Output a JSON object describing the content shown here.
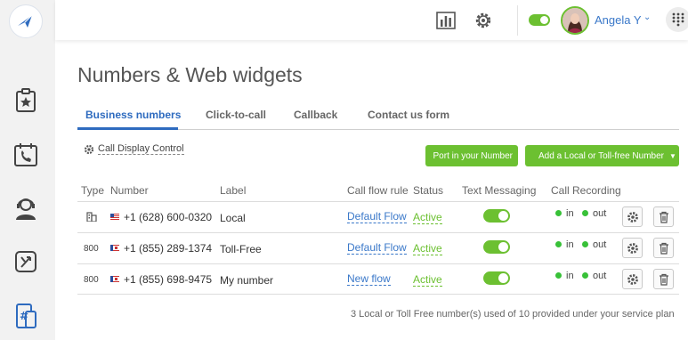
{
  "page": {
    "title": "Numbers & Web widgets"
  },
  "topbar": {
    "user_name": "Angela Y",
    "toggle_on": true
  },
  "sidebar": {
    "items": [
      {
        "icon": "clipboard-star-icon"
      },
      {
        "icon": "calendar-phone-icon"
      },
      {
        "icon": "agent-headset-icon"
      },
      {
        "icon": "call-flow-icon"
      },
      {
        "icon": "numbers-hash-icon"
      }
    ]
  },
  "tabs": [
    {
      "label": "Business numbers",
      "active": true
    },
    {
      "label": "Click-to-call",
      "active": false
    },
    {
      "label": "Callback",
      "active": false
    },
    {
      "label": "Contact us form",
      "active": false
    }
  ],
  "actions": {
    "call_display_control": "Call Display Control",
    "port_number": "Port in your Number",
    "add_number": "Add a Local or Toll-free Number"
  },
  "table": {
    "headers": [
      "Type",
      "Number",
      "Label",
      "Call flow rule",
      "Status",
      "Text Messaging",
      "Call Recording"
    ],
    "rows": [
      {
        "type": "",
        "type_icon": "building-icon",
        "number": "+1 (628) 600-0320",
        "label": "Local",
        "flow": "Default Flow",
        "status": "Active",
        "text_on": true,
        "rec_in": "in",
        "rec_out": "out"
      },
      {
        "type": "800",
        "number": "+1 (855) 289-1374",
        "label": "Toll-Free",
        "flow": "Default Flow",
        "status": "Active",
        "text_on": true,
        "rec_in": "in",
        "rec_out": "out"
      },
      {
        "type": "800",
        "number": "+1 (855) 698-9475",
        "label": "My number",
        "flow": "New flow",
        "status": "Active",
        "text_on": true,
        "rec_in": "in",
        "rec_out": "out"
      }
    ]
  },
  "footer": {
    "note": "3 Local or Toll Free number(s) used of 10 provided under your service plan"
  },
  "colors": {
    "accent_green": "#6cc031",
    "link_blue": "#3a78c9",
    "tab_blue": "#2e6bbf"
  }
}
